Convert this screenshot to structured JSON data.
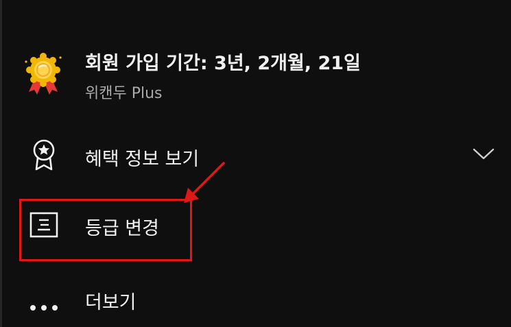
{
  "membership": {
    "title": "회원 가입 기간: 3년, 2개월, 21일",
    "subtitle": "위캔두 Plus",
    "badge_icon": "membership-badge-icon"
  },
  "menu": {
    "items": [
      {
        "label": "혜택 정보 보기",
        "icon": "award-ribbon-icon",
        "expandable": true,
        "chevron_icon": "chevron-down-icon"
      },
      {
        "label": "등급 변경",
        "icon": "tier-list-icon"
      },
      {
        "label": "더보기",
        "icon": "more-dots-icon"
      }
    ]
  },
  "annotation": {
    "highlight_color": "#e01818",
    "highlighted_item": "등급 변경"
  },
  "colors": {
    "background": "#0f0f0f",
    "primary_text": "#f1f1f1",
    "secondary_text": "#aaaaaa",
    "badge_gold": "#f2b705",
    "badge_ribbon": "#e53935"
  }
}
